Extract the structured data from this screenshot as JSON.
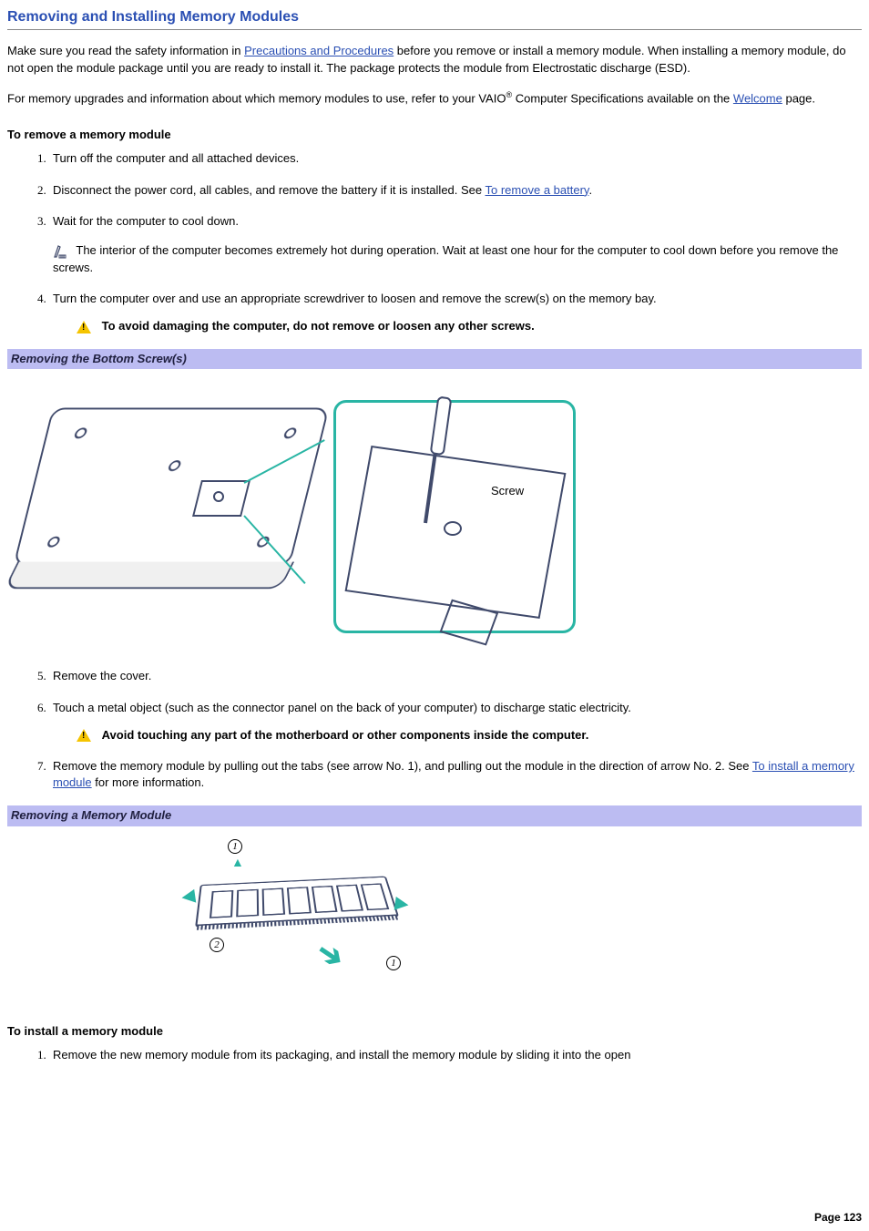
{
  "title": "Removing and Installing Memory Modules",
  "intro": {
    "p1_pre": "Make sure you read the safety information in ",
    "link1": "Precautions and Procedures",
    "p1_post": " before you remove or install a memory module. When installing a memory module, do not open the module package until you are ready to install it. The package protects the module from Electrostatic discharge (ESD).",
    "p2_pre": "For memory upgrades and information about which memory modules to use, refer to your VAIO",
    "p2_reg": "®",
    "p2_mid": " Computer Specifications available on the ",
    "link2": "Welcome",
    "p2_post": " page."
  },
  "remove": {
    "heading": "To remove a memory module",
    "s1": "Turn off the computer and all attached devices.",
    "s2_pre": "Disconnect the power cord, all cables, and remove the battery if it is installed. See ",
    "s2_link": "To remove a battery",
    "s2_post": ".",
    "s3": "Wait for the computer to cool down.",
    "s3_note": " The interior of the computer becomes extremely hot during operation. Wait at least one hour for the computer to cool down before you remove the screws.",
    "s4": "Turn the computer over and use an appropriate screwdriver to loosen and remove the screw(s) on the memory bay.",
    "s4_warn": "To avoid damaging the computer, do not remove or loosen any other screws.",
    "caption1": "Removing the Bottom Screw(s)",
    "fig1_label": "Screw",
    "s5": "Remove the cover.",
    "s6": "Touch a metal object (such as the connector panel on the back of your computer) to discharge static electricity.",
    "s6_warn": "Avoid touching any part of the motherboard or other components inside the computer.",
    "s7_pre": "Remove the memory module by pulling out the tabs (see arrow No. 1), and pulling out the module in the direction of arrow No. 2. See ",
    "s7_link": "To install a memory module",
    "s7_post": " for more information.",
    "caption2": "Removing a Memory Module",
    "fig2_c1": "1",
    "fig2_c2": "2"
  },
  "install": {
    "heading": "To install a memory module",
    "s1": "Remove the new memory module from its packaging, and install the memory module by sliding it into the open"
  },
  "page_number": "Page 123"
}
